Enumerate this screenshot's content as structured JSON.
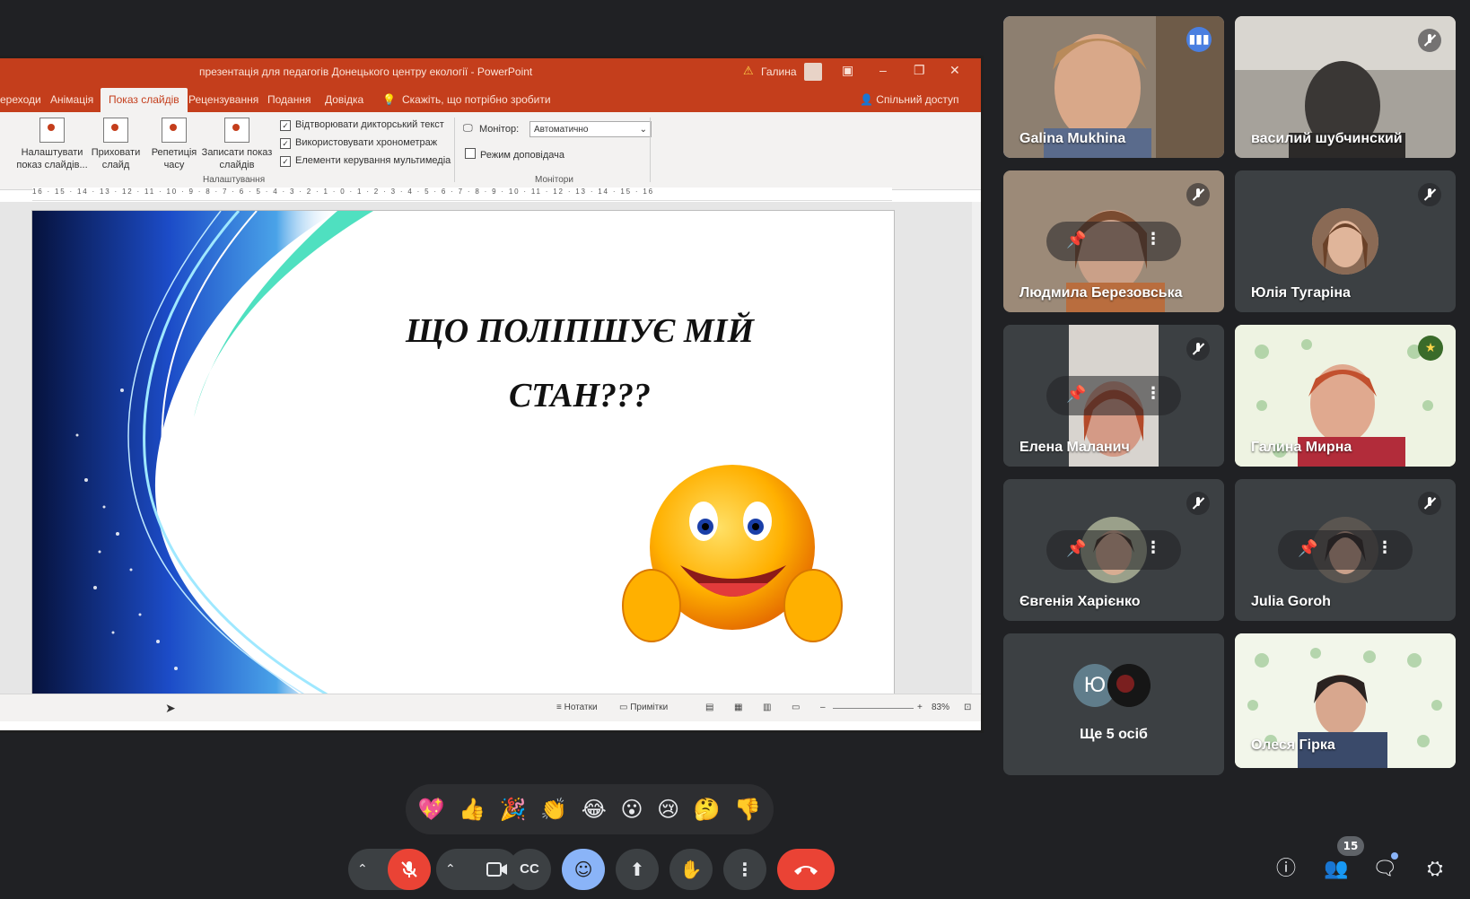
{
  "powerpoint": {
    "document_title": "презентація для педагогів Донецького центру екології  -  PowerPoint",
    "user_name": "Галина",
    "tabs": [
      "ереходи",
      "Анімація",
      "Показ слайдів",
      "Рецензування",
      "Подання",
      "Довідка"
    ],
    "tell_me": "Скажіть, що потрібно зробити",
    "share": "Спільний доступ",
    "ribbon": {
      "btn_setup": "Налаштувати показ слайдів...",
      "btn_hide": "Приховати слайд",
      "btn_rehearse": "Репетиція часу",
      "btn_record": "Записати показ слайдів",
      "chk_narration": "Відтворювати дикторський текст",
      "chk_timings": "Використовувати хронометраж",
      "chk_media": "Елементи керування мультимедіа",
      "group_setup": "Налаштування",
      "monitor_label": "Монітор:",
      "monitor_value": "Автоматично",
      "presenter_view": "Режим доповідача",
      "group_monitors": "Монітори"
    },
    "ruler": "16 · 15 · 14 · 13 · 12 · 11 · 10 · 9 · 8 · 7 · 6 · 5 · 4 · 3 · 2 · 1 · 0 · 1 · 2 · 3 · 4 · 5 · 6 · 7 · 8 · 9 · 10 · 11 · 12 · 13 · 14 · 15 · 16",
    "slide": {
      "title_line1": "ЩО ПОЛІПШУЄ МІЙ",
      "title_line2": "СТАН???"
    },
    "status": {
      "notes": "Нотатки",
      "comments": "Примітки",
      "zoom": "83%"
    }
  },
  "participants": [
    {
      "name": "Galina Mukhina",
      "speaking": true
    },
    {
      "name": "василий шубчинский",
      "muted": true
    },
    {
      "name": "Людмила Березовська",
      "muted": true
    },
    {
      "name": "Юлія Тугаріна",
      "muted": true
    },
    {
      "name": "Елена Маланич",
      "muted": true
    },
    {
      "name": "Галина Мирна"
    },
    {
      "name": "Євгенія Харієнко",
      "muted": true
    },
    {
      "name": "Julia Goroh",
      "muted": true
    },
    {
      "name": "Ще 5 осіб",
      "avatar_letter": "Ю"
    },
    {
      "name": "Олеся Гірка"
    }
  ],
  "reactions": [
    "💖",
    "👍",
    "🎉",
    "👏",
    "😂",
    "😮",
    "😢",
    "🤔",
    "👎"
  ],
  "controls": {
    "people_count": "15",
    "accent": "#8ab4f8",
    "danger": "#ea4335"
  }
}
